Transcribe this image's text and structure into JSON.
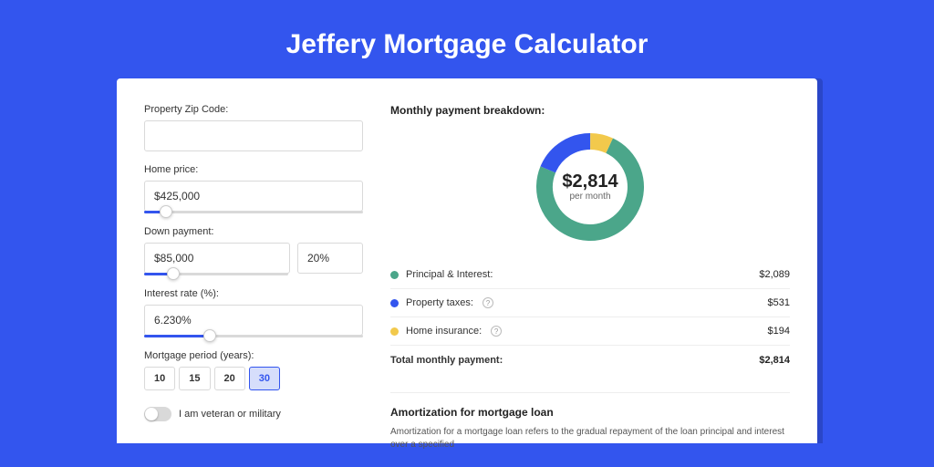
{
  "title": "Jeffery Mortgage Calculator",
  "form": {
    "zip_label": "Property Zip Code:",
    "zip_value": "",
    "home_price_label": "Home price:",
    "home_price_value": "$425,000",
    "home_price_slider_pct": 10,
    "down_payment_label": "Down payment:",
    "down_payment_amount": "$85,000",
    "down_payment_pct": "20%",
    "down_payment_slider_pct": 20,
    "interest_label": "Interest rate (%):",
    "interest_value": "6.230%",
    "interest_slider_pct": 30,
    "period_label": "Mortgage period (years):",
    "periods": [
      "10",
      "15",
      "20",
      "30"
    ],
    "period_active_index": 3,
    "veteran_label": "I am veteran or military"
  },
  "breakdown": {
    "title": "Monthly payment breakdown:",
    "center_amount": "$2,814",
    "center_label": "per month",
    "items": [
      {
        "label": "Principal & Interest:",
        "value": "$2,089",
        "color": "green",
        "help": false
      },
      {
        "label": "Property taxes:",
        "value": "$531",
        "color": "blue",
        "help": true
      },
      {
        "label": "Home insurance:",
        "value": "$194",
        "color": "yellow",
        "help": true
      }
    ],
    "total_label": "Total monthly payment:",
    "total_value": "$2,814"
  },
  "chart_data": {
    "type": "pie",
    "title": "Monthly payment breakdown",
    "series": [
      {
        "name": "Principal & Interest",
        "value": 2089,
        "color": "#4ba68a"
      },
      {
        "name": "Property taxes",
        "value": 531,
        "color": "#3355ee"
      },
      {
        "name": "Home insurance",
        "value": 194,
        "color": "#f2c94c"
      }
    ],
    "total": 2814,
    "unit": "USD per month"
  },
  "amortization": {
    "title": "Amortization for mortgage loan",
    "text": "Amortization for a mortgage loan refers to the gradual repayment of the loan principal and interest over a specified"
  }
}
